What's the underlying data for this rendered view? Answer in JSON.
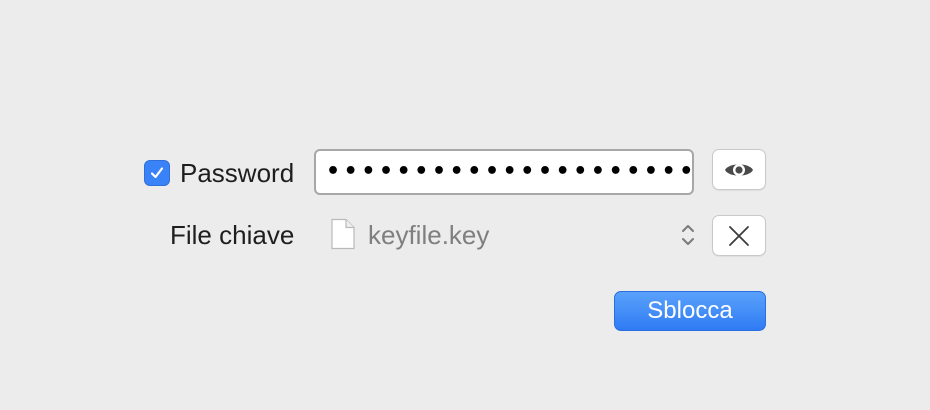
{
  "password": {
    "checkbox_checked": true,
    "label": "Password",
    "masked_value": "•••••••••••••••••••••••••",
    "reveal_icon": "eye-icon"
  },
  "key_file": {
    "label": "File chiave",
    "value": "keyfile.key",
    "file_icon": "document-icon",
    "stepper_icon": "chevron-up-down-icon",
    "clear_icon": "close-icon"
  },
  "actions": {
    "unlock_label": "Sblocca"
  },
  "colors": {
    "accent": "#3a82f7",
    "background": "#ececec"
  }
}
